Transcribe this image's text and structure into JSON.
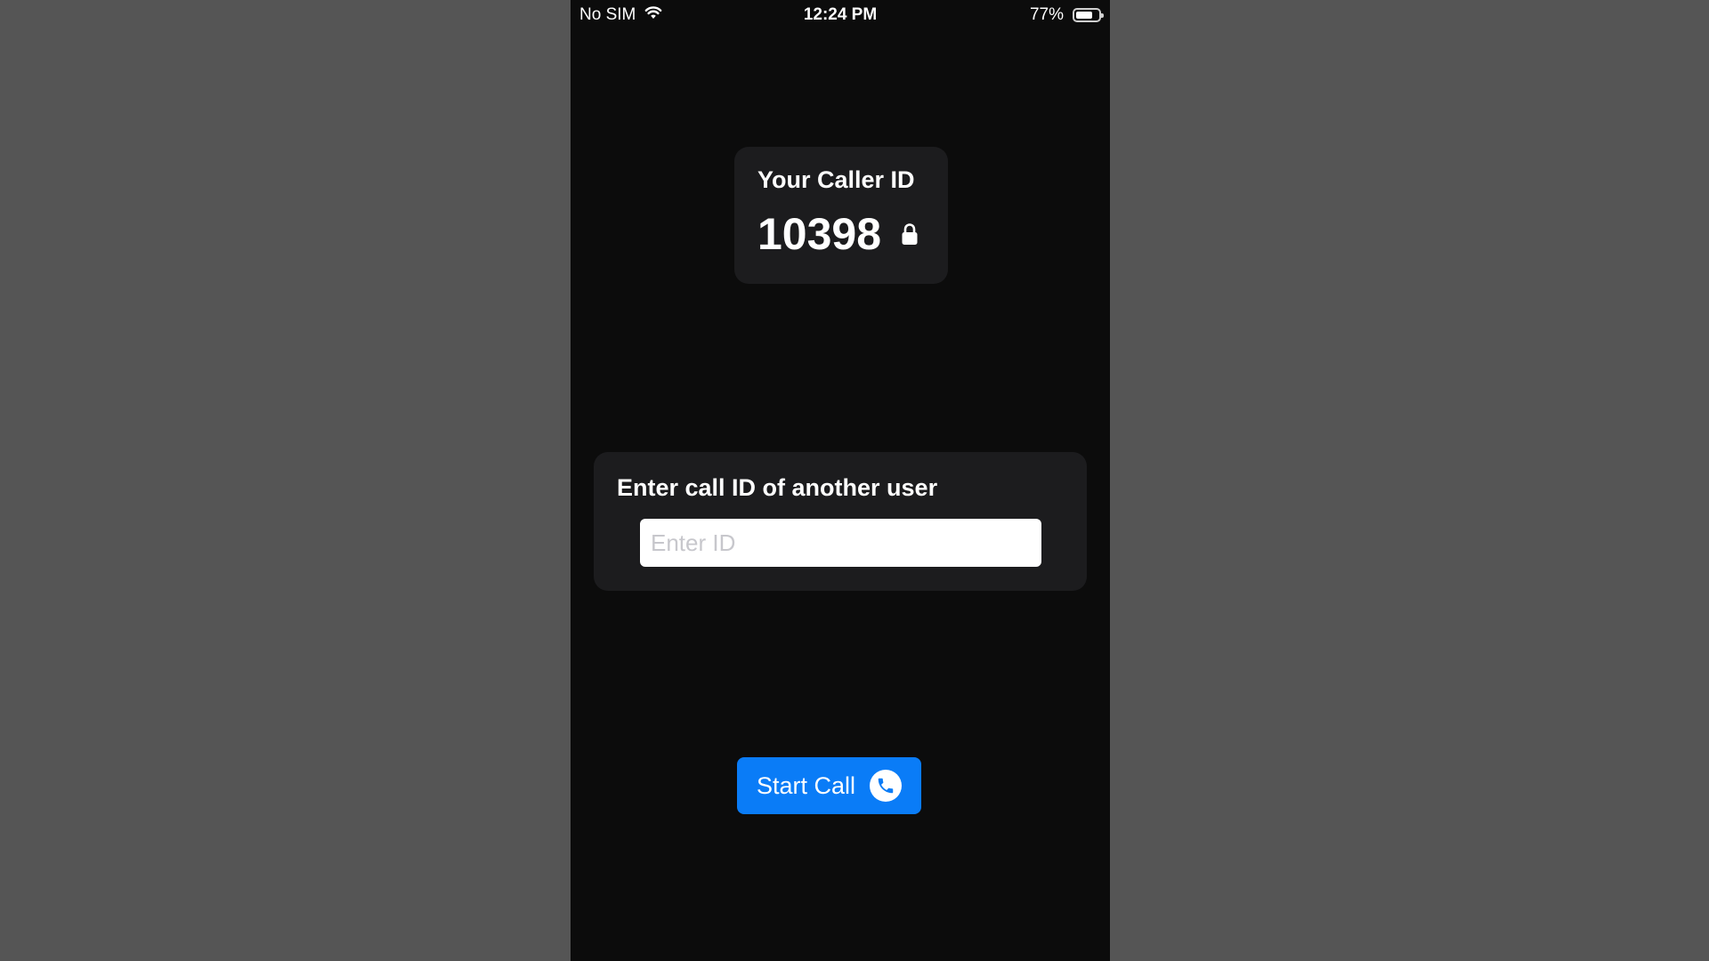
{
  "status_bar": {
    "carrier": "No SIM",
    "time": "12:24 PM",
    "battery_percent_label": "77%",
    "battery_level": 0.77
  },
  "caller_card": {
    "title": "Your Caller ID",
    "number": "10398"
  },
  "call_card": {
    "title": "Enter call ID of another user",
    "input_value": "",
    "input_placeholder": "Enter ID"
  },
  "start_call": {
    "label": "Start Call"
  },
  "colors": {
    "background": "#555555",
    "screen": "#0c0c0c",
    "card": "#1c1c1e",
    "accent": "#0a7cf7"
  },
  "icons": [
    "wifi-icon",
    "battery-icon",
    "lock-icon",
    "phone-icon"
  ]
}
